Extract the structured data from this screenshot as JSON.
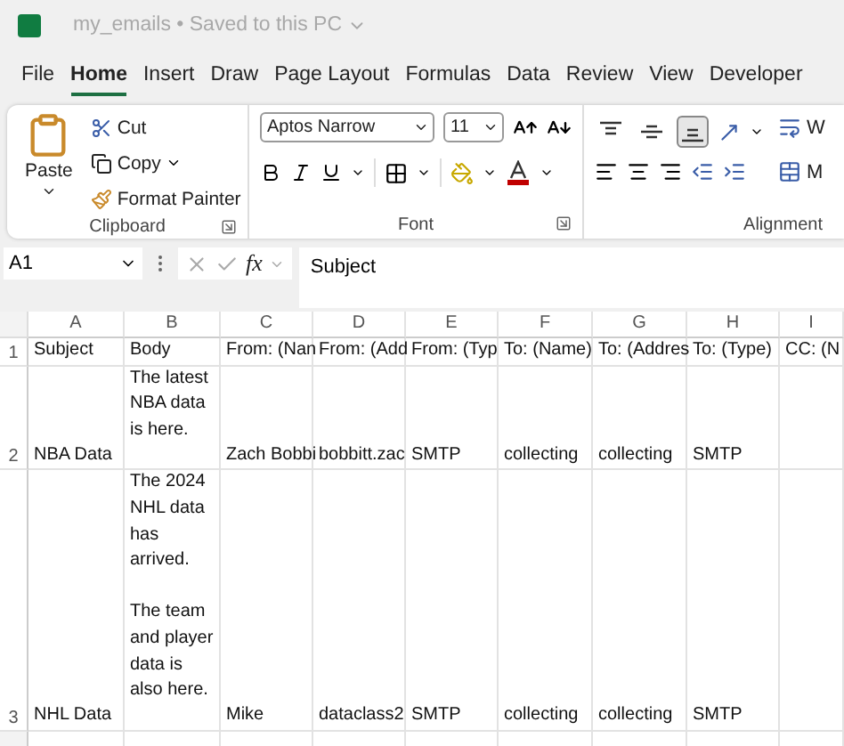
{
  "title_bar": {
    "title": "my_emails • Saved to this PC"
  },
  "menu_tabs": [
    {
      "label": "File",
      "selected": false
    },
    {
      "label": "Home",
      "selected": true
    },
    {
      "label": "Insert",
      "selected": false
    },
    {
      "label": "Draw",
      "selected": false
    },
    {
      "label": "Page Layout",
      "selected": false
    },
    {
      "label": "Formulas",
      "selected": false
    },
    {
      "label": "Data",
      "selected": false
    },
    {
      "label": "Review",
      "selected": false
    },
    {
      "label": "View",
      "selected": false
    },
    {
      "label": "Developer",
      "selected": false
    }
  ],
  "ribbon": {
    "clipboard": {
      "paste": "Paste",
      "cut": "Cut",
      "copy": "Copy",
      "format_painter": "Format Painter",
      "label": "Clipboard"
    },
    "font": {
      "font_name": "Aptos Narrow",
      "font_size": "11",
      "label": "Font"
    },
    "alignment": {
      "label": "Alignment",
      "vertical_align": [
        {
          "selected": false
        },
        {
          "selected": false
        },
        {
          "selected": true
        }
      ],
      "wrap_text": "W",
      "merge": "M"
    }
  },
  "formula_bar": {
    "name_box": "A1",
    "function_button": "fx",
    "value": "Subject"
  },
  "sheet": {
    "columns": [
      "A",
      "B",
      "C",
      "D",
      "E",
      "F",
      "G",
      "H",
      "I"
    ],
    "rows": [
      {
        "number": "1",
        "cells": [
          "Subject",
          "Body",
          "From: (Nan",
          "From: (Add",
          "From: (Typ",
          "To: (Name)",
          "To: (Addres",
          "To: (Type)",
          "CC: (N"
        ]
      },
      {
        "number": "2",
        "cells": [
          "NBA Data",
          "The latest\nNBA data\nis here.",
          "Zach Bobbi",
          "bobbitt.zac",
          "SMTP",
          "collecting",
          "collecting",
          "SMTP",
          ""
        ]
      },
      {
        "number": "3",
        "cells": [
          "NHL Data",
          "The 2024\nNHL data\nhas\narrived.\n\nThe team\nand player\ndata is\nalso here.",
          "Mike",
          "dataclass2",
          "SMTP",
          "collecting",
          "collecting",
          "SMTP",
          ""
        ]
      }
    ]
  }
}
